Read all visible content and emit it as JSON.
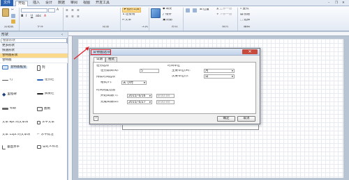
{
  "ribbon": {
    "tabs": [
      "文件",
      "开始",
      "插入",
      "设计",
      "数据",
      "审阅",
      "视图",
      "开发工具"
    ],
    "clipboard_group": "剪贴板",
    "font_group": "字体",
    "paragraph_group": "段落",
    "tools_group": "工具",
    "shape_group": "形状",
    "arrange_group": "排列",
    "edit_group": "编辑",
    "pointer_tool": "指针工具",
    "connector_tool": "连接线",
    "text_tool": "文本",
    "fill": "填充",
    "line": "线条",
    "shadow": "阴影",
    "bring_forward": "上移一层",
    "send_backward": "下移一层",
    "position": "位置",
    "find": "查找",
    "layer": "图层",
    "select": "选择"
  },
  "shapes_panel": {
    "title": "形状",
    "search_placeholder": "搜索形状",
    "stencils": [
      "更多形状",
      "快速形状",
      "甘特图形状",
      "甘特图"
    ],
    "items": [
      {
        "label": "甘特图框架",
        "icon": "gantt-frame-icon"
      },
      {
        "label": "列",
        "icon": "column-icon"
      },
      {
        "label": "行",
        "icon": "row-icon"
      },
      {
        "label": "任务栏",
        "icon": "taskbar-icon"
      },
      {
        "label": "里程碑",
        "icon": "milestone-icon"
      },
      {
        "label": "摘要栏",
        "icon": "summary-bar-icon"
      },
      {
        "label": "标题",
        "icon": "title-icon"
      },
      {
        "label": "图例",
        "icon": "legend-icon"
      },
      {
        "label": "文本 8pt 的文本块",
        "icon": "text-block-icon"
      },
      {
        "label": "水平文本",
        "icon": "horizontal-text-icon"
      },
      {
        "label": "文本 12pt 的文本块",
        "icon": "text-block-large-icon"
      },
      {
        "label": "水平标注",
        "icon": "horizontal-callout-icon"
      },
      {
        "label": "垂直水平",
        "icon": "vertical-horizontal-icon"
      },
      {
        "label": "自定义标注",
        "icon": "custom-callout-icon"
      }
    ]
  },
  "dialog": {
    "title": "甘特图选项",
    "tabs": [
      "日期",
      "格式"
    ],
    "task_options_label": "任务选项",
    "task_count_label": "任务数目(N):",
    "task_count_value": "5",
    "duration_options_label": "持续时间选项",
    "format_label": "格式(F):",
    "format_value": "天 小时",
    "time_unit_label": "时间单位",
    "major_unit_label": "主要单位(M):",
    "major_unit_value": "月",
    "minor_unit_label": "次要单位(I):",
    "minor_unit_value": "日",
    "timescale_label": "时间刻度范围",
    "start_date_label": "开始日期(T):",
    "start_date_value": "2015/ 6/16",
    "start_time_value": "8:00:00",
    "finish_date_label": "完成日期(D):",
    "finish_date_value": "2015/ 6/27",
    "finish_time_value": "8:00:00",
    "ok": "确定",
    "cancel": "取消",
    "help": "?"
  },
  "colors": {
    "annotation": "#e0232b",
    "file_tab": "#2d63b3"
  }
}
